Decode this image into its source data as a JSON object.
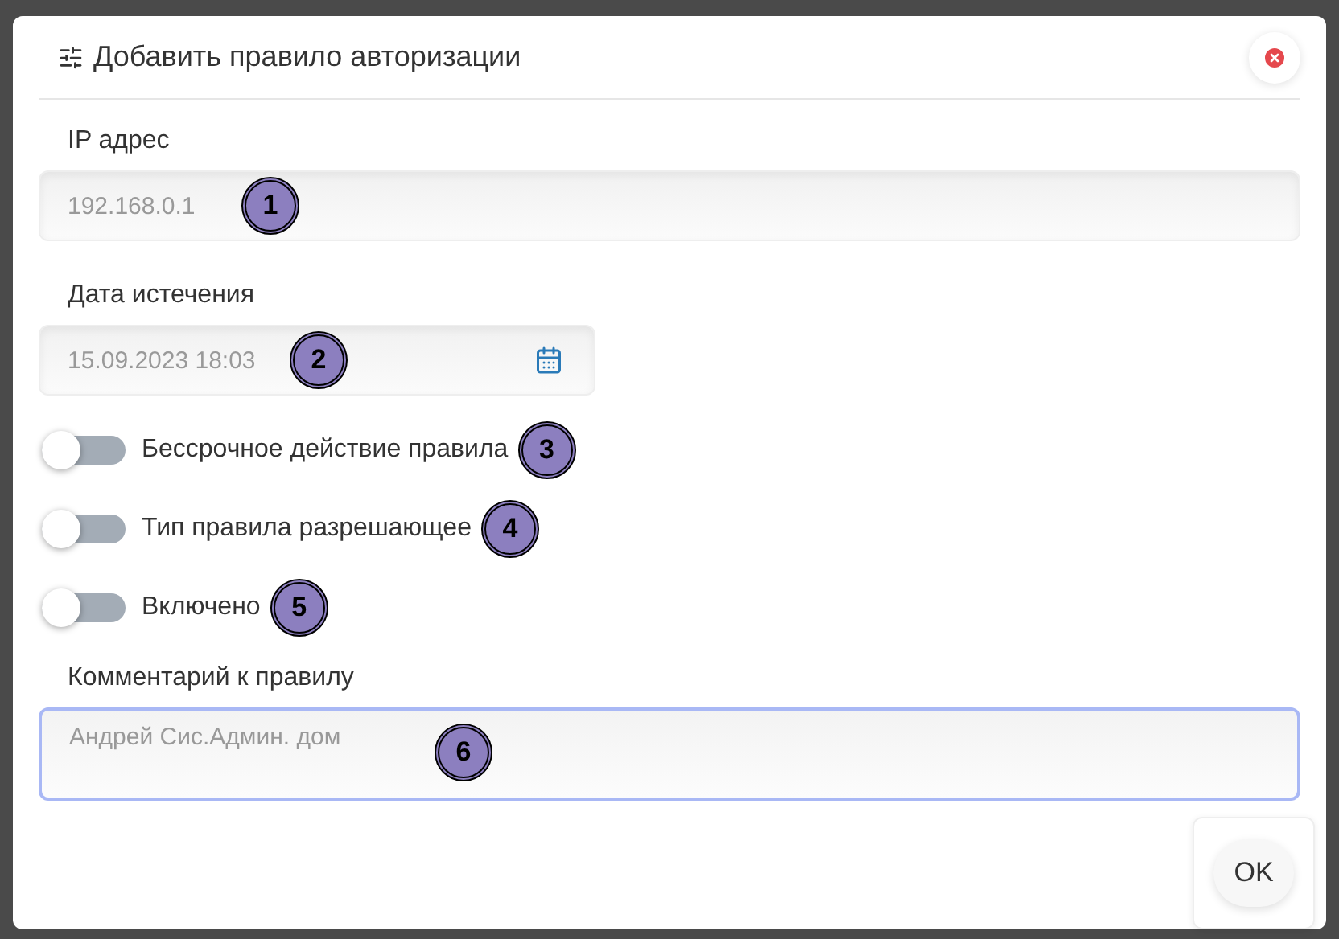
{
  "dialog": {
    "title": "Добавить правило авторизации"
  },
  "fields": [
    {
      "kind": "text",
      "label": "IP адрес",
      "placeholder": "192.168.0.1",
      "callout": "1"
    },
    {
      "kind": "date",
      "label": "Дата истечения",
      "placeholder": "15.09.2023 18:03",
      "callout": "2"
    }
  ],
  "toggles": [
    {
      "label": "Бессрочное действие правила",
      "on": false,
      "callout": "3"
    },
    {
      "label": "Тип правила разрешающее",
      "on": false,
      "callout": "4"
    },
    {
      "label": "Включено",
      "on": false,
      "callout": "5"
    }
  ],
  "comment": {
    "label": "Комментарий к правилу",
    "placeholder": "Андрей Сис.Админ. дом",
    "callout": "6"
  },
  "buttons": [
    "OK"
  ]
}
